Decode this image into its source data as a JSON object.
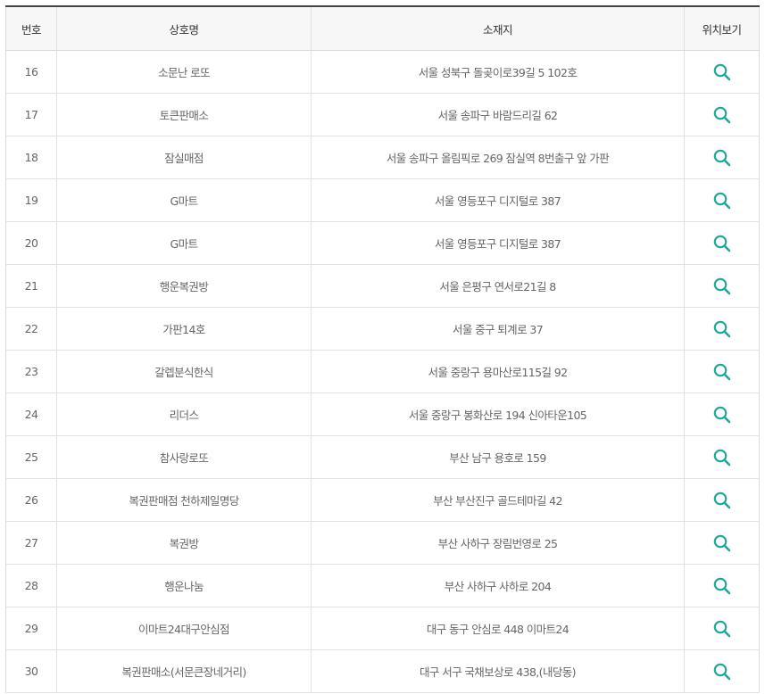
{
  "table": {
    "headers": {
      "number": "번호",
      "name": "상호명",
      "address": "소재지",
      "location": "위치보기"
    },
    "rows": [
      {
        "no": "16",
        "name": "소문난 로또",
        "address": "서울 성북구 돌곶이로39길 5 102호"
      },
      {
        "no": "17",
        "name": "토큰판매소",
        "address": "서울 송파구 바람드리길 62"
      },
      {
        "no": "18",
        "name": "잠실매점",
        "address": "서울 송파구 올림픽로 269 잠실역 8번출구 앞 가판"
      },
      {
        "no": "19",
        "name": "G마트",
        "address": "서울 영등포구 디지털로 387"
      },
      {
        "no": "20",
        "name": "G마트",
        "address": "서울 영등포구 디지털로 387"
      },
      {
        "no": "21",
        "name": "행운복권방",
        "address": "서울 은평구 연서로21길 8"
      },
      {
        "no": "22",
        "name": "가판14호",
        "address": "서울 중구 퇴계로 37"
      },
      {
        "no": "23",
        "name": "갈렙분식한식",
        "address": "서울 중랑구 용마산로115길 92"
      },
      {
        "no": "24",
        "name": "리더스",
        "address": "서울 중랑구 봉화산로 194 신아타운105"
      },
      {
        "no": "25",
        "name": "참사랑로또",
        "address": "부산 남구 용호로 159"
      },
      {
        "no": "26",
        "name": "복권판매점 천하제일명당",
        "address": "부산 부산진구 골드테마길 42"
      },
      {
        "no": "27",
        "name": "복권방",
        "address": "부산 사하구 장림번영로 25"
      },
      {
        "no": "28",
        "name": "행운나눔",
        "address": "부산 사하구 사하로 204"
      },
      {
        "no": "29",
        "name": "이마트24대구안심점",
        "address": "대구 동구 안심로 448 이마트24"
      },
      {
        "no": "30",
        "name": "복권판매소(서문큰장네거리)",
        "address": "대구 서구 국채보상로 438,(내당동)"
      }
    ],
    "icon": {
      "name": "search-icon",
      "color": "#1fa89a"
    }
  }
}
